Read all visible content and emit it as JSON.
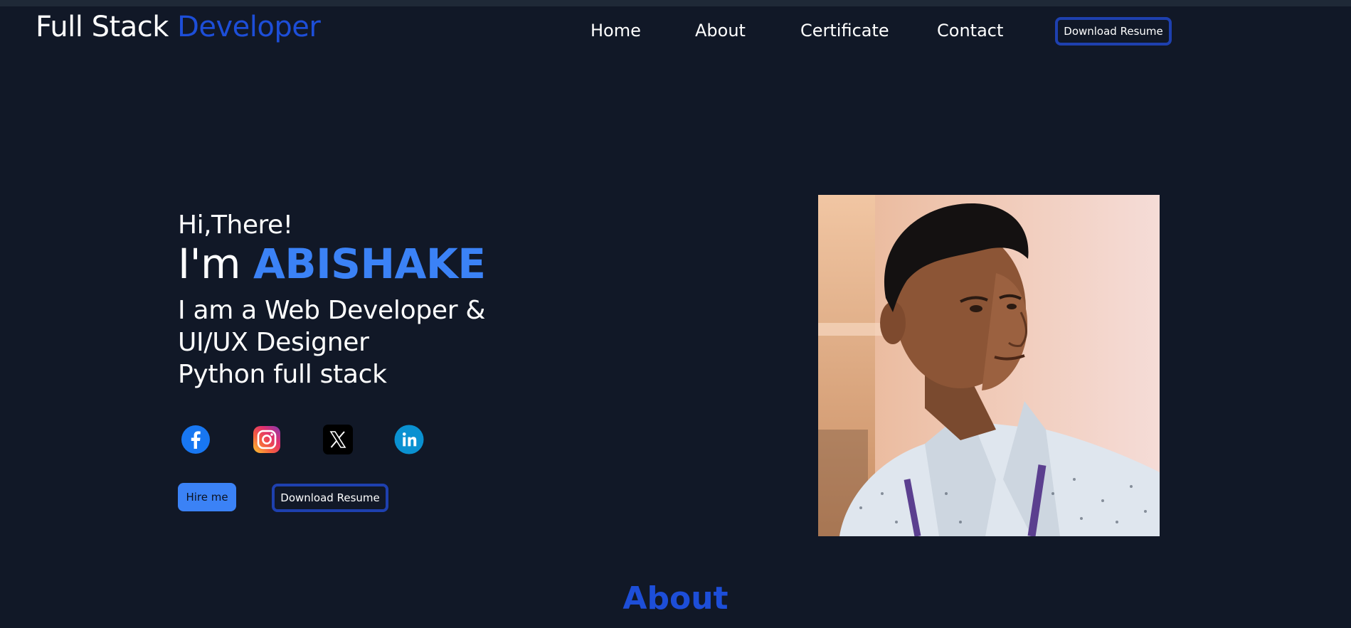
{
  "header": {
    "brand_first": "Full Stack",
    "brand_accent": "Developer",
    "nav": {
      "home": "Home",
      "about": "About",
      "certificate": "Certificate",
      "contact": "Contact"
    },
    "resume_button": "Download Resume"
  },
  "hero": {
    "greeting": "Hi,There!",
    "intro_prefix": "I'm",
    "name": "ABISHAKE",
    "roles": [
      "I am a Web Developer &",
      "UI/UX Designer",
      "Python full stack"
    ],
    "social_icons": [
      "facebook-icon",
      "instagram-icon",
      "x-icon",
      "linkedin-icon"
    ],
    "hire_button": "Hire me",
    "resume_button": "Download Resume"
  },
  "about": {
    "heading": "About"
  },
  "colors": {
    "background": "#111827",
    "accent": "#1d4ed8",
    "name_accent": "#3b82f6",
    "button_border": "#1e40af"
  }
}
